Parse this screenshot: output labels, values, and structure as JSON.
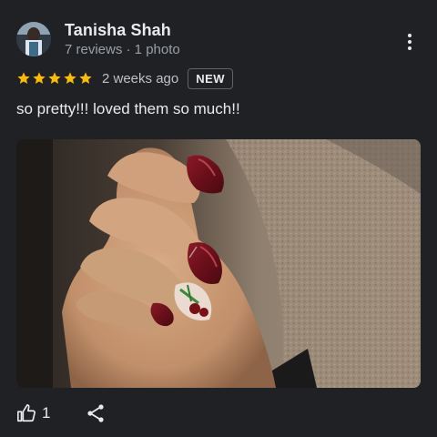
{
  "review": {
    "author_name": "Tanisha Shah",
    "author_meta": "7 reviews · 1 photo",
    "rating": 5,
    "star_color": "#fbbc04",
    "time_ago": "2 weeks ago",
    "badge": "NEW",
    "text": "so pretty!!! loved them so much!!"
  },
  "actions": {
    "like_icon": "thumbs-up-icon",
    "like_count": "1",
    "share_icon": "share-icon",
    "more_icon": "more-vert-icon"
  }
}
